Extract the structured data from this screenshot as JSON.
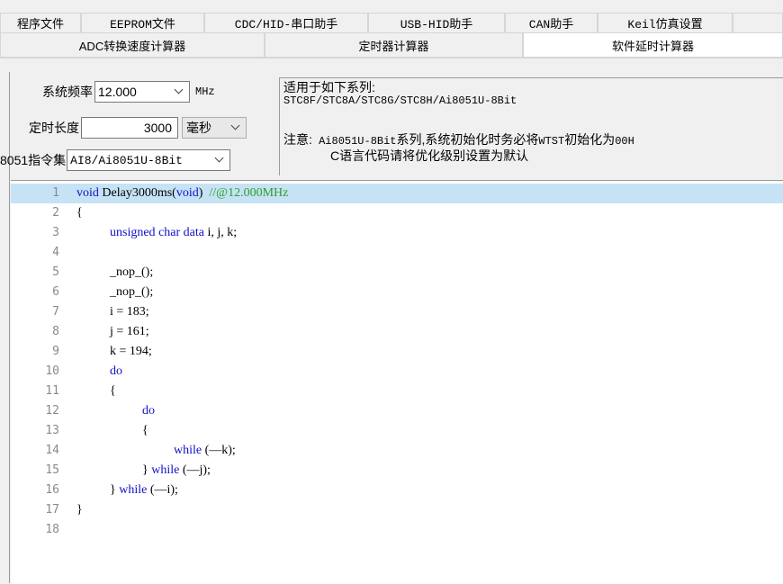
{
  "tabs_row1": [
    "程序文件",
    "EEPROM文件",
    "CDC/HID-串口助手",
    "USB-HID助手",
    "CAN助手",
    "Keil仿真设置"
  ],
  "tabs_row2": [
    "ADC转换速度计算器",
    "定时器计算器",
    "软件延时计算器"
  ],
  "active_tab": "软件延时计算器",
  "settings": {
    "freq_label": "系统频率",
    "freq_value": "12.000",
    "freq_unit": "MHz",
    "duration_label": "定时长度",
    "duration_value": "3000",
    "duration_unit": "毫秒",
    "instr_label": "8051指令集",
    "instr_value": "AI8/Ai8051U-8Bit"
  },
  "info": {
    "applies_title": "适用于如下系列:",
    "series": "STC8F/STC8A/STC8G/STC8H/Ai8051U-8Bit",
    "note_label": "注意:",
    "note_model": "Ai8051U-8Bit",
    "note_text1": "系列,系统初始化时务必将",
    "note_reg": "WTST",
    "note_text2": "初始化为",
    "note_val": "00H",
    "note_line2": "C语言代码请将优化级别设置为默认"
  },
  "code": {
    "line_numbers": [
      "1",
      "2",
      "3",
      "4",
      "5",
      "6",
      "7",
      "8",
      "9",
      "10",
      "11",
      "12",
      "13",
      "14",
      "15",
      "16",
      "17",
      "18"
    ],
    "fn_void": "void",
    "fn_name": " Delay3000ms(",
    "fn_param": "void",
    "fn_close": ")  ",
    "fn_comment": "//@12.000MHz",
    "open_brace": "{",
    "decl_kw1": "unsigned",
    "decl_kw2": "char",
    "decl_kw3": "data",
    "decl_rest": " i, j, k;",
    "nop1": "_nop_();",
    "nop2": "_nop_();",
    "assign_i": "i = 183;",
    "assign_j": "j = 161;",
    "assign_k": "k = 194;",
    "do1": "do",
    "brace_open2": "{",
    "do2": "do",
    "brace_open3": "{",
    "while_kw1": "while",
    "while_cond1": " (—k);",
    "close_brace3": "} ",
    "while_kw2": "while",
    "while_cond2": " (—j);",
    "close_brace2": "} ",
    "while_kw3": "while",
    "while_cond3": " (—i);",
    "close_brace1": "}"
  }
}
